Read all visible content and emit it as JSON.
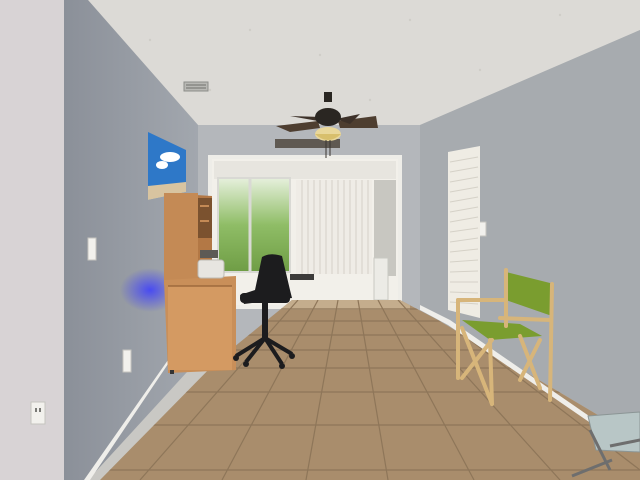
{
  "scene": {
    "kind": "interior-photo",
    "subject": "hallway",
    "colors": {
      "ceiling": "#dcdad6",
      "wall_left": "#9ea4ad",
      "wall_right": "#a7abaf",
      "wall_far": "#b4b7bb",
      "floor_tile": "#a98d6c",
      "grout": "#8e7659",
      "baseboard": "#efeeea",
      "desk_wood": "#c48a55",
      "chair_green": "#7a9d2f",
      "chair_frame": "#d7b57a"
    },
    "objects": [
      "ceiling-fan",
      "ceiling-vent",
      "wall-painting",
      "wooden-desk",
      "office-chair",
      "doorway",
      "sliding-glass-door",
      "vertical-blinds",
      "louvered-closet-door",
      "director-chair",
      "electrical-outlet",
      "light-switch",
      "glass-side-table"
    ]
  }
}
